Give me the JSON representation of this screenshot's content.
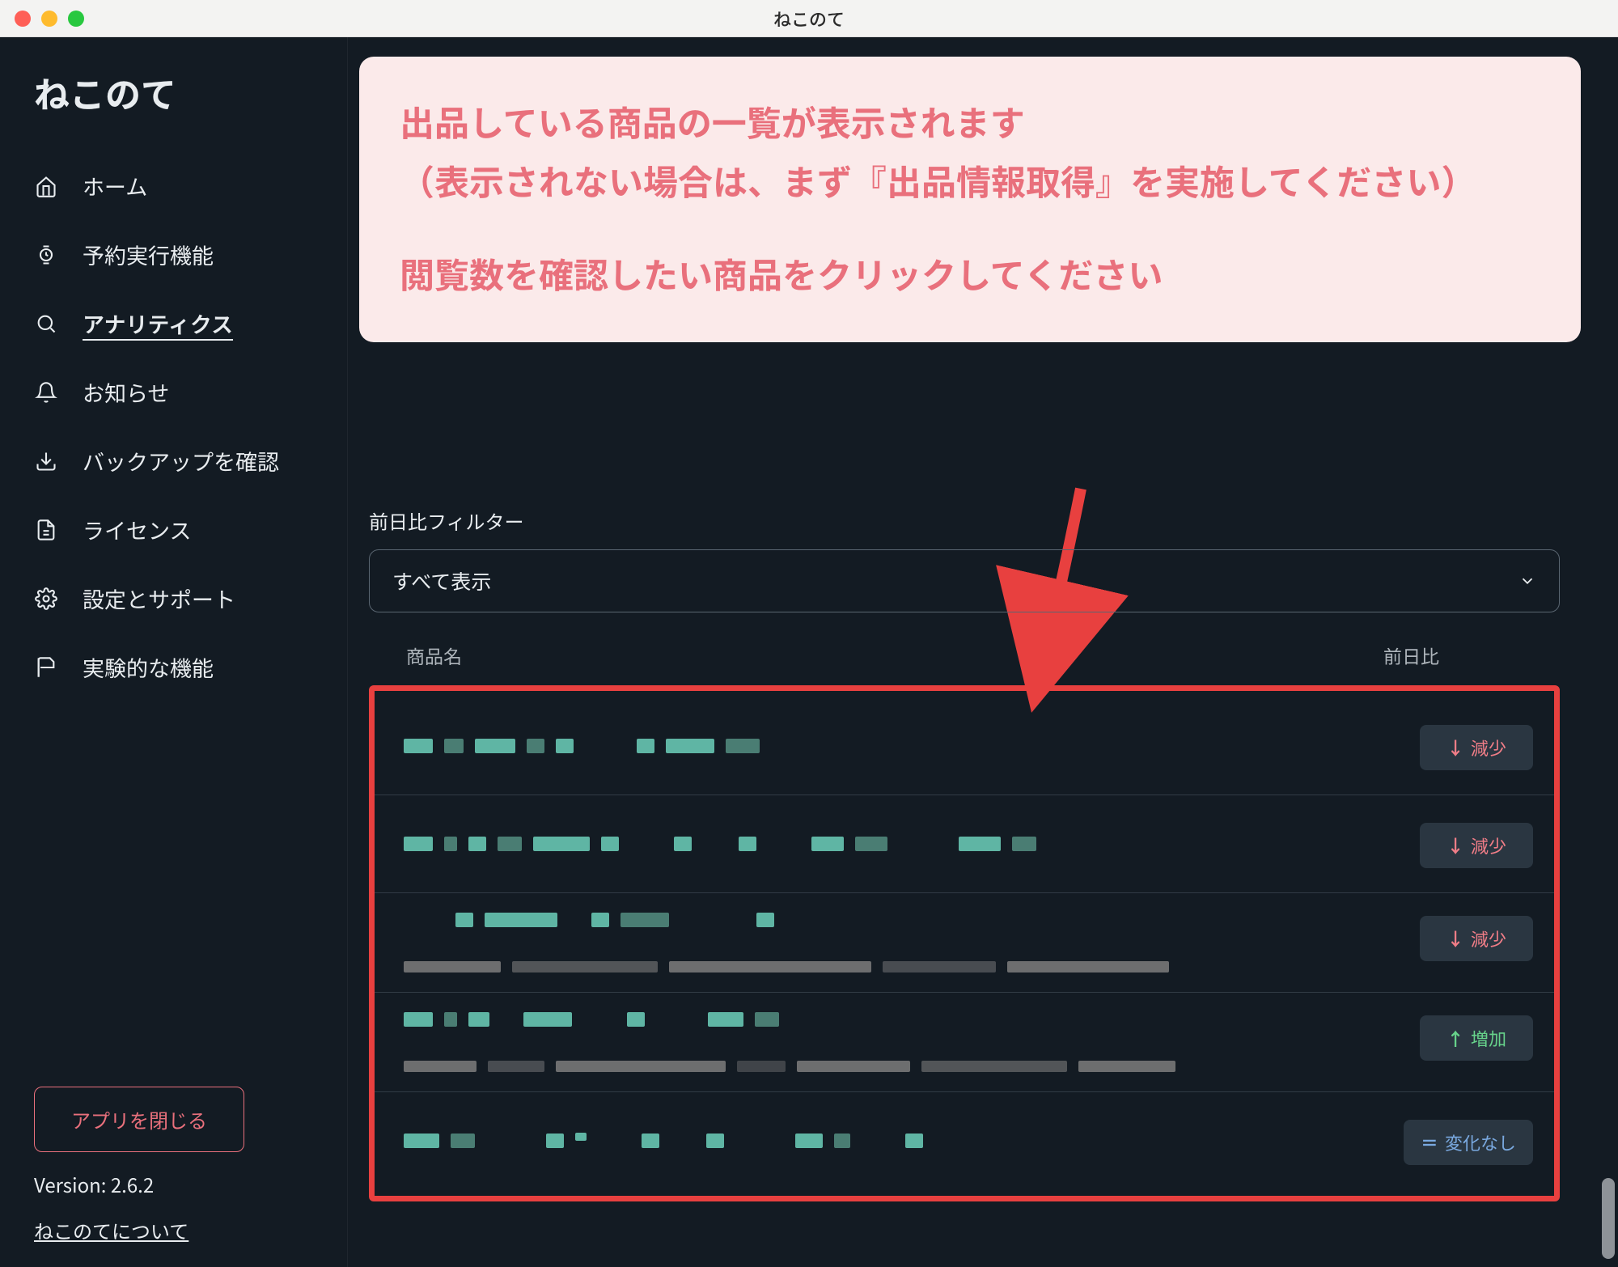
{
  "window": {
    "title": "ねこのて"
  },
  "app": {
    "name": "ねこのて"
  },
  "sidebar": {
    "items": [
      {
        "label": "ホーム",
        "icon": "home-icon"
      },
      {
        "label": "予約実行機能",
        "icon": "watch-icon"
      },
      {
        "label": "アナリティクス",
        "icon": "search-icon",
        "active": true
      },
      {
        "label": "お知らせ",
        "icon": "bell-icon"
      },
      {
        "label": "バックアップを確認",
        "icon": "download-icon"
      },
      {
        "label": "ライセンス",
        "icon": "document-icon"
      },
      {
        "label": "設定とサポート",
        "icon": "gear-icon"
      },
      {
        "label": "実験的な機能",
        "icon": "flag-icon"
      }
    ],
    "close_button": "アプリを閉じる",
    "version_prefix": "Version: ",
    "version": "2.6.2",
    "about": "ねこのてについて"
  },
  "callout": {
    "line1": "出品している商品の一覧が表示されます",
    "line2": "（表示されない場合は、まず『出品情報取得』を実施してください）",
    "line3": "閲覧数を確認したい商品をクリックしてください"
  },
  "filter": {
    "label": "前日比フィルター",
    "selected": "すべて表示"
  },
  "table": {
    "headers": {
      "name": "商品名",
      "diff": "前日比"
    },
    "badges": {
      "decrease": "減少",
      "increase": "増加",
      "none": "変化なし"
    },
    "rows": [
      {
        "diff": "decrease"
      },
      {
        "diff": "decrease"
      },
      {
        "diff": "decrease"
      },
      {
        "diff": "increase"
      },
      {
        "diff": "none"
      }
    ]
  }
}
